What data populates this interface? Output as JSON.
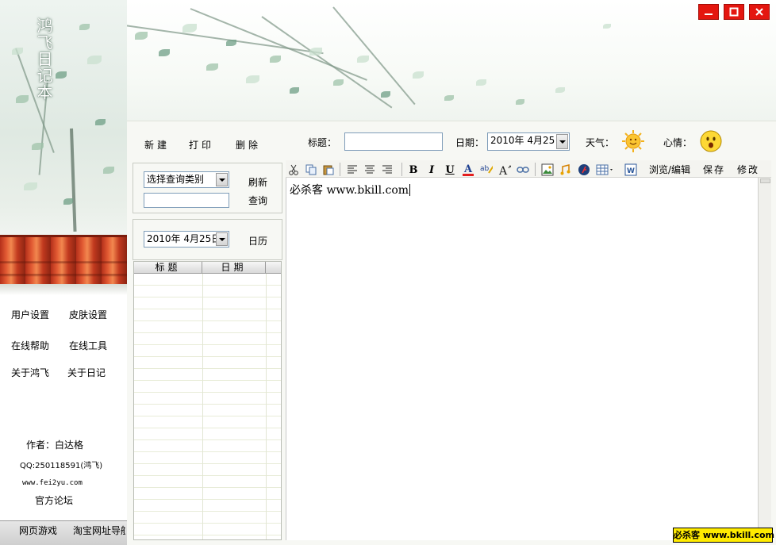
{
  "app": {
    "title": "鸿飞日记本"
  },
  "window_controls": {
    "minimize": "minimize",
    "maximize": "maximize",
    "close": "close"
  },
  "left_menu": {
    "user_settings": "用户设置",
    "skin_settings": "皮肤设置",
    "online_help": "在线帮助",
    "online_tools": "在线工具",
    "about_hongfei": "关于鸿飞",
    "about_diary": "关于日记",
    "author": "作者：白达格",
    "qq": "QQ:250118591(鸿飞)",
    "website": "www.fei2yu.com",
    "forum": "官方论坛"
  },
  "bottom_bar": {
    "web_games": "网页游戏",
    "taobao_nav": "淘宝网址导航"
  },
  "actions": {
    "new": "新建",
    "print": "打印",
    "delete": "删除"
  },
  "query": {
    "category_selected": "选择查询类别",
    "keyword_value": "",
    "refresh": "刷新",
    "search": "查询"
  },
  "calendar": {
    "date_value": "2010年 4月25日",
    "button": "日历"
  },
  "list": {
    "columns": [
      "标题",
      "日期"
    ],
    "rows": []
  },
  "entry": {
    "title_label": "标题：",
    "title_value": "",
    "date_label": "日期：",
    "date_value": "2010年 4月25日",
    "weather_label": "天气：",
    "mood_label": "心情：",
    "weather_icon": "sun-icon",
    "mood_icon": "smiley-icon"
  },
  "toolbar": {
    "icons": [
      "cut-icon",
      "copy-icon",
      "paste-icon",
      "align-left-icon",
      "align-center-icon",
      "align-right-icon",
      "bold-icon",
      "italic-icon",
      "underline-icon",
      "font-color-icon",
      "highlight-icon",
      "font-size-icon",
      "link-icon",
      "image-icon",
      "music-icon",
      "flash-icon",
      "table-icon",
      "word-icon"
    ],
    "browse_edit": "浏览/编辑",
    "save": "保存",
    "modify": "修改"
  },
  "editor": {
    "content": "必杀客 www.bkill.com"
  },
  "watermark": {
    "text": "必杀客 www.bkill.com"
  },
  "colors": {
    "close_red": "#e4160f",
    "panel_bg": "#f7f8f4",
    "border_blue": "#7f9db9",
    "watermark_yellow": "#ffeb00"
  }
}
